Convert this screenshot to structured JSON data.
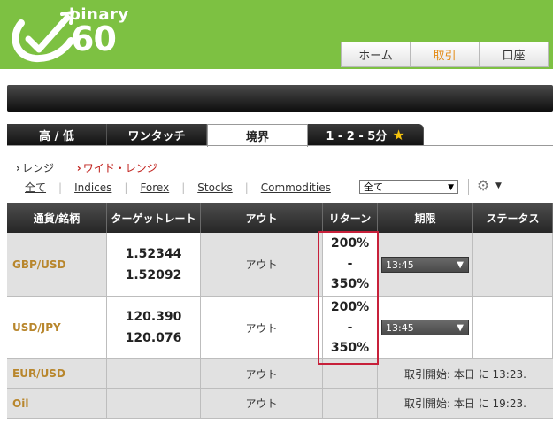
{
  "header": {
    "logo_word": "binary",
    "logo_num": "60",
    "nav": [
      {
        "label": "ホーム",
        "active": false
      },
      {
        "label": "取引",
        "active": true
      },
      {
        "label": "口座",
        "active": false
      }
    ]
  },
  "tabs": [
    {
      "label": "高 / 低"
    },
    {
      "label": "ワンタッチ"
    },
    {
      "label": "境界"
    },
    {
      "label": "1 - 2 - 5分"
    }
  ],
  "subfilters": [
    "レンジ",
    "ワイド・レンジ"
  ],
  "categories": [
    "全て",
    "Indices",
    "Forex",
    "Stocks",
    "Commodities"
  ],
  "category_select": "全て",
  "table": {
    "headers": [
      "通貨/銘柄",
      "ターゲットレート",
      "アウト",
      "リターン",
      "期限",
      "ステータス"
    ],
    "rows": [
      {
        "symbol": "GBP/USD",
        "rate1": "1.52344",
        "rate2": "1.52092",
        "out": "アウト",
        "ret1": "200%",
        "ret_sep": "-",
        "ret2": "350%",
        "expiry": "13:45"
      },
      {
        "symbol": "USD/JPY",
        "rate1": "120.390",
        "rate2": "120.076",
        "out": "アウト",
        "ret1": "200%",
        "ret_sep": "-",
        "ret2": "350%",
        "expiry": "13:45"
      },
      {
        "symbol": "EUR/USD",
        "out": "アウト",
        "status": "取引開始: 本日 に 13:23."
      },
      {
        "symbol": "Oil",
        "out": "アウト",
        "status": "取引開始: 本日 に 19:23."
      }
    ]
  },
  "colors": {
    "header_green": "#7dc142",
    "active_nav": "#e38a14",
    "highlight": "#c7203a",
    "symbol": "#b8862c"
  }
}
